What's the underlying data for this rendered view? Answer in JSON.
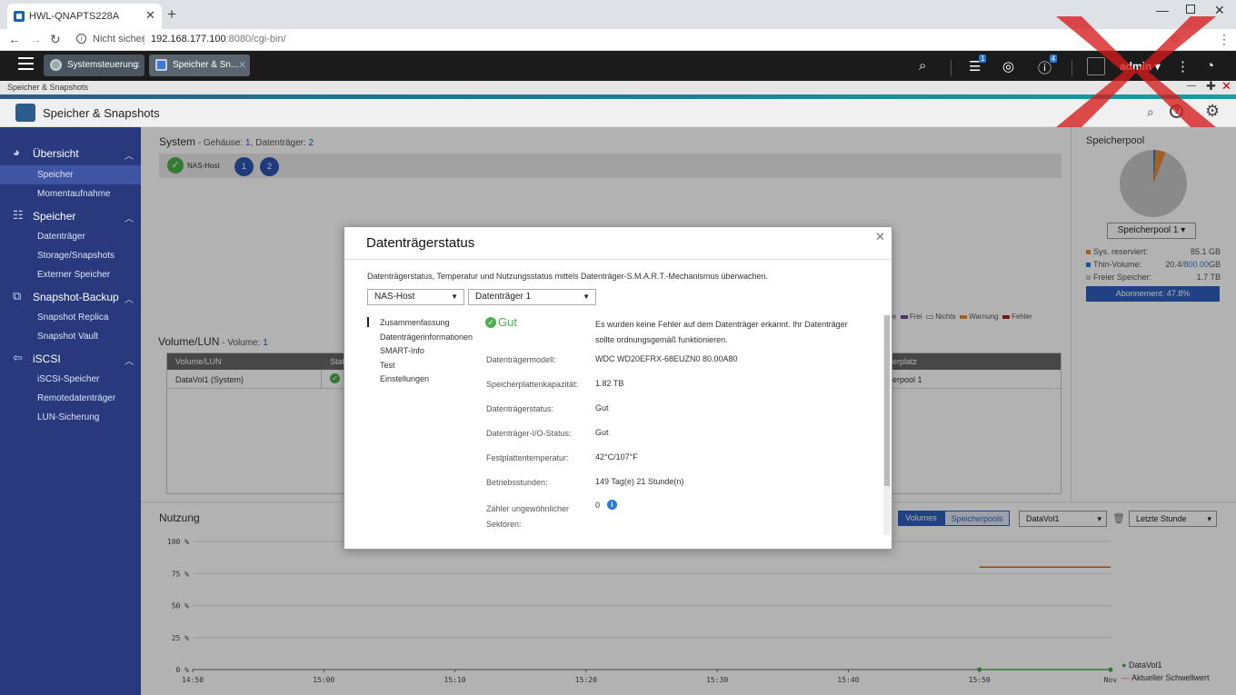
{
  "browser": {
    "tab_title": "HWL-QNAPTS228A",
    "not_secure": "Nicht sicher",
    "url_host": "192.168.177.100",
    "url_rest": ":8080/cgi-bin/"
  },
  "qts": {
    "tabs": [
      "Systemsteuerung",
      "Speicher & Sn..."
    ],
    "user": "admin",
    "badges": {
      "tasks": "1",
      "info": "4"
    }
  },
  "app": {
    "breadcrumb": "Speicher & Snapshots",
    "title": "Speicher & Snapshots"
  },
  "sidebar": {
    "groups": [
      {
        "label": "Übersicht",
        "items": [
          "Speicher",
          "Momentaufnahme"
        ]
      },
      {
        "label": "Speicher",
        "items": [
          "Datenträger",
          "Storage/Snapshots",
          "Externer Speicher"
        ]
      },
      {
        "label": "Snapshot-Backup",
        "items": [
          "Snapshot Replica",
          "Snapshot Vault"
        ]
      },
      {
        "label": "iSCSI",
        "items": [
          "iSCSI-Speicher",
          "Remotedatenträger",
          "LUN-Sicherung"
        ]
      }
    ]
  },
  "system": {
    "title": "System",
    "label_enclosure": " - Gehäuse: ",
    "enclosures": "1",
    "label_disks": ", Datenträger: ",
    "disks": "2",
    "nas_host": "NAS-Host",
    "disk_slots": [
      "1",
      "2"
    ]
  },
  "legend_bar": {
    "partial": "rve",
    "free": "Frei",
    "none": "Nichts",
    "warning": "Warnung",
    "error": "Fehler"
  },
  "volume": {
    "title": "Volume/LUN",
    "label_count": " - Volume: ",
    "count": "1",
    "headers": {
      "col1": "Volume/LUN",
      "col2": "Statu",
      "col3": "erplatz"
    },
    "row": {
      "name": "DataVol1 (System)",
      "location": "erpool 1"
    }
  },
  "pool": {
    "title": "Speicherpool",
    "selected": "Speicherpool 1",
    "legend": [
      {
        "label": "Sys. reserviert:",
        "value": "85.1 GB",
        "color": "#e88a2e"
      },
      {
        "label": "Thin-Volume:",
        "value_a": "20.4/",
        "value_b": "800.00",
        "value_c": "GB",
        "color": "#2a7ad5"
      },
      {
        "label": "Freier Speicher:",
        "value": "1.7 TB",
        "color": "#c6c6c6"
      }
    ],
    "subscription": "Abonnement: 47.8%"
  },
  "usage": {
    "title": "Nutzung",
    "toggle": [
      "Volumes",
      "Speicherpools"
    ],
    "volume_select": "DataVol1",
    "range_select": "Letzte Stunde",
    "legend": [
      "DataVol1",
      "Aktueller Schwellwert"
    ]
  },
  "chart_data": {
    "type": "line",
    "x": [
      "14:50",
      "15:00",
      "15:10",
      "15:20",
      "15:30",
      "15:40",
      "15:50",
      "Nov"
    ],
    "y_ticks": [
      "100 %",
      "75 %",
      "50 %",
      "25 %",
      "0 %"
    ],
    "ylim": [
      0,
      100
    ],
    "series": [
      {
        "name": "DataVol1",
        "color": "#4caf50",
        "points": [
          [
            "15:50",
            0
          ],
          [
            "Nov",
            0
          ]
        ]
      },
      {
        "name": "Aktueller Schwellwert",
        "color": "#e06020",
        "points": [
          [
            "15:50",
            80
          ],
          [
            "Nov",
            80
          ]
        ]
      }
    ]
  },
  "dialog": {
    "title": "Datenträgerstatus",
    "description": "Datenträgerstatus, Temperatur und Nutzungsstatus mittels Datenträger-S.M.A.R.T.-Mechanismus überwachen.",
    "host_select": "NAS-Host",
    "disk_select": "Datenträger 1",
    "nav": [
      "Zusammenfassung",
      "Datenträgerinformationen",
      "SMART-Info",
      "Test",
      "Einstellungen"
    ],
    "status": "Gut",
    "status_message": "Es wurden keine Fehler auf dem Datenträger erkannt. Ihr Datenträger sollte ordnungsgemäß funktionieren.",
    "fields": [
      {
        "label": "Datenträgermodell:",
        "value": "WDC WD20EFRX-68EUZN0 80.00A80"
      },
      {
        "label": "Speicherplattenkapazität:",
        "value": "1.82 TB"
      },
      {
        "label": "Datenträgerstatus:",
        "value": "Gut"
      },
      {
        "label": "Datenträger-I/O-Status:",
        "value": "Gut"
      },
      {
        "label": "Festplattentemperatur:",
        "value": "42°C/107°F"
      },
      {
        "label": "Betriebsstunden:",
        "value": "149 Tag(e) 21 Stunde(n)"
      },
      {
        "label": "Zähler ungewöhnlicher Sektoren:",
        "value": "0"
      }
    ]
  }
}
